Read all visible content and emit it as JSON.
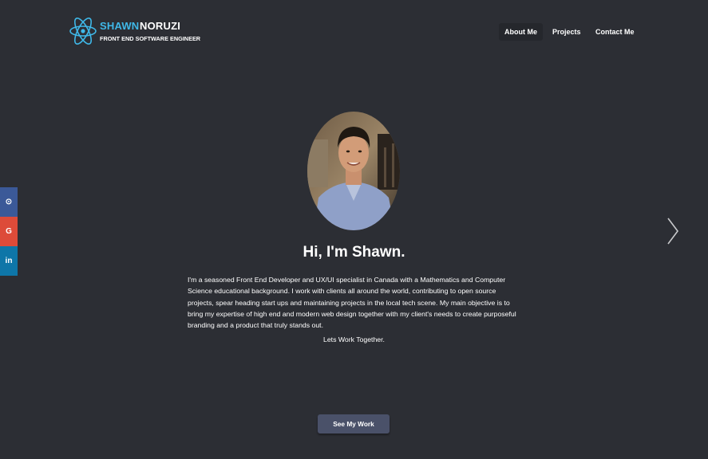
{
  "colors": {
    "background": "#2c2e34",
    "accent": "#3fb8e8",
    "github": "#3b5998",
    "google": "#dd4b39",
    "linkedin": "#0e76a8",
    "button": "#4a5169"
  },
  "header": {
    "brand_first": "SHAWN",
    "brand_last": "NORUZI",
    "brand_subtitle": "FRONT END SOFTWARE ENGINEER",
    "logo_icon": "atom-icon"
  },
  "nav": {
    "items": [
      {
        "label": "About Me",
        "active": true
      },
      {
        "label": "Projects",
        "active": false
      },
      {
        "label": "Contact Me",
        "active": false
      }
    ]
  },
  "social": [
    {
      "name": "github-icon",
      "glyph": "⊙"
    },
    {
      "name": "google-icon",
      "glyph": "G"
    },
    {
      "name": "linkedin-icon",
      "glyph": "in"
    }
  ],
  "hero": {
    "avatar": "profile-photo",
    "heading": "Hi, I'm Shawn.",
    "bio": "I'm a seasoned Front End Developer and UX/UI specialist in Canada with a Mathematics and Computer Science educational background. I work with clients all around the world, contributing to open source projects, spear heading start ups and maintaining projects in the local tech scene. My main objective is to bring my expertise of high end and modern web design together with my client's needs to create purposeful branding and a product that truly stands out.",
    "tagline": "Lets Work Together.",
    "cta_label": "See My Work",
    "next_icon": "chevron-right-icon"
  }
}
